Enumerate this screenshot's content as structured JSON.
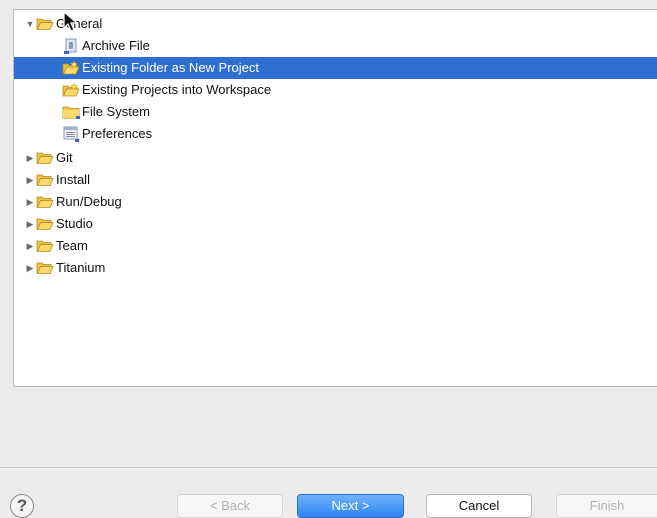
{
  "tree": {
    "items": [
      {
        "label": "General",
        "icon": "folder-open-icon",
        "expanded": true,
        "level": 0
      },
      {
        "label": "Archive File",
        "icon": "archive-file-icon",
        "level": 1
      },
      {
        "label": "Existing Folder as New Project",
        "icon": "folder-project-icon",
        "level": 1,
        "selected": true
      },
      {
        "label": "Existing Projects into Workspace",
        "icon": "folder-project-icon",
        "level": 1
      },
      {
        "label": "File System",
        "icon": "folder-icon",
        "level": 1
      },
      {
        "label": "Preferences",
        "icon": "preferences-icon",
        "level": 1
      },
      {
        "label": "Git",
        "icon": "folder-open-icon",
        "expanded": false,
        "level": 0
      },
      {
        "label": "Install",
        "icon": "folder-open-icon",
        "expanded": false,
        "level": 0
      },
      {
        "label": "Run/Debug",
        "icon": "folder-open-icon",
        "expanded": false,
        "level": 0
      },
      {
        "label": "Studio",
        "icon": "folder-open-icon",
        "expanded": false,
        "level": 0
      },
      {
        "label": "Team",
        "icon": "folder-open-icon",
        "expanded": false,
        "level": 0
      },
      {
        "label": "Titanium",
        "icon": "folder-open-icon",
        "expanded": false,
        "level": 0
      }
    ]
  },
  "buttons": {
    "help": "?",
    "back": "< Back",
    "next": "Next >",
    "cancel": "Cancel",
    "finish": "Finish"
  },
  "colors": {
    "selection": "#2f6fd1",
    "primary_button": "#2d84f2",
    "folder": "#f5c542"
  }
}
